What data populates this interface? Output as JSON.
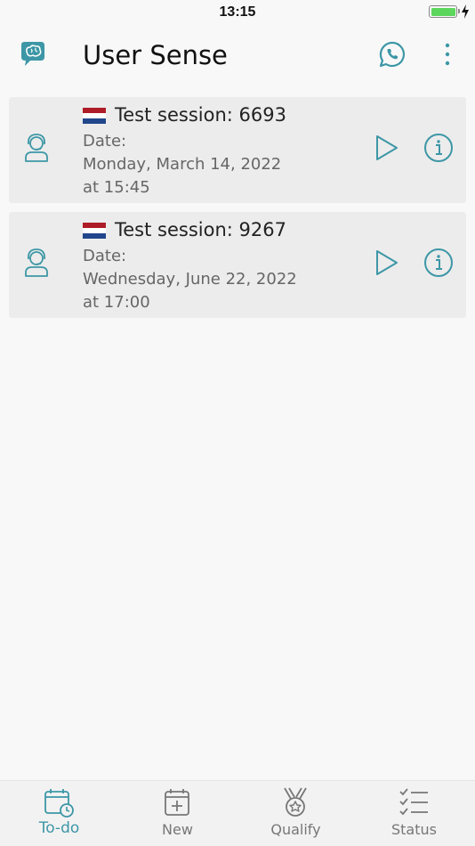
{
  "status_bar": {
    "time": "13:15"
  },
  "app_bar": {
    "title": "User Sense"
  },
  "colors": {
    "accent": "#3d97a6",
    "card_bg": "#ececec",
    "flag_red": "#ae1c28",
    "flag_white": "#ffffff",
    "flag_blue": "#21468b"
  },
  "sessions": [
    {
      "title": "Test session: 6693",
      "date_label": "Date:",
      "date": "Monday, March 14, 2022",
      "time": "at 15:45"
    },
    {
      "title": "Test session: 9267",
      "date_label": "Date:",
      "date": "Wednesday, June 22, 2022",
      "time": "at 17:00"
    }
  ],
  "tabs": [
    {
      "label": "To-do",
      "icon": "calendar-clock-icon",
      "active": true
    },
    {
      "label": "New",
      "icon": "calendar-plus-icon",
      "active": false
    },
    {
      "label": "Qualify",
      "icon": "medal-icon",
      "active": false
    },
    {
      "label": "Status",
      "icon": "checklist-icon",
      "active": false
    }
  ]
}
